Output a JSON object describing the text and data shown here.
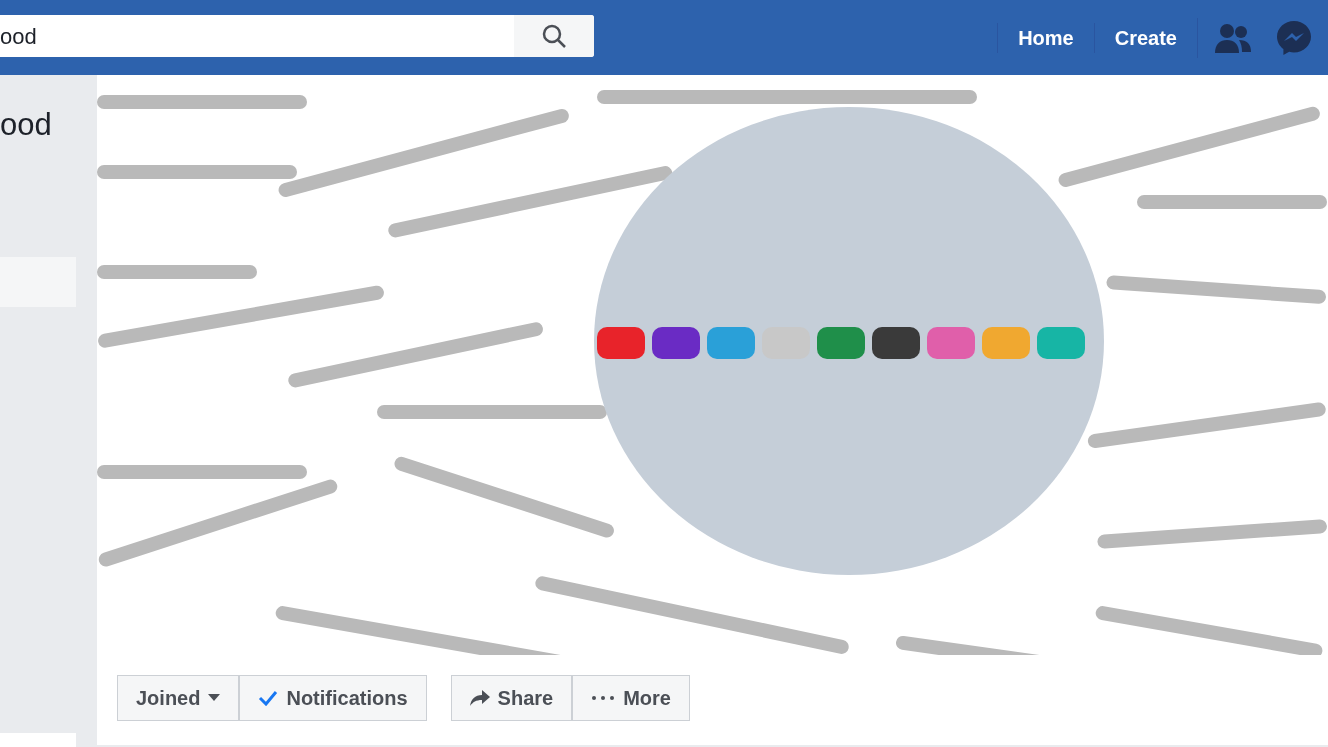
{
  "search": {
    "value": "ood"
  },
  "nav": [
    "Home",
    "Create"
  ],
  "sidebar": {
    "group_name": "ood"
  },
  "actions": [
    {
      "label": "Joined",
      "kind": "dropdown"
    },
    {
      "label": "Notifications",
      "kind": "check"
    },
    {
      "label": "Share",
      "kind": "share"
    },
    {
      "label": "More",
      "kind": "more"
    }
  ]
}
